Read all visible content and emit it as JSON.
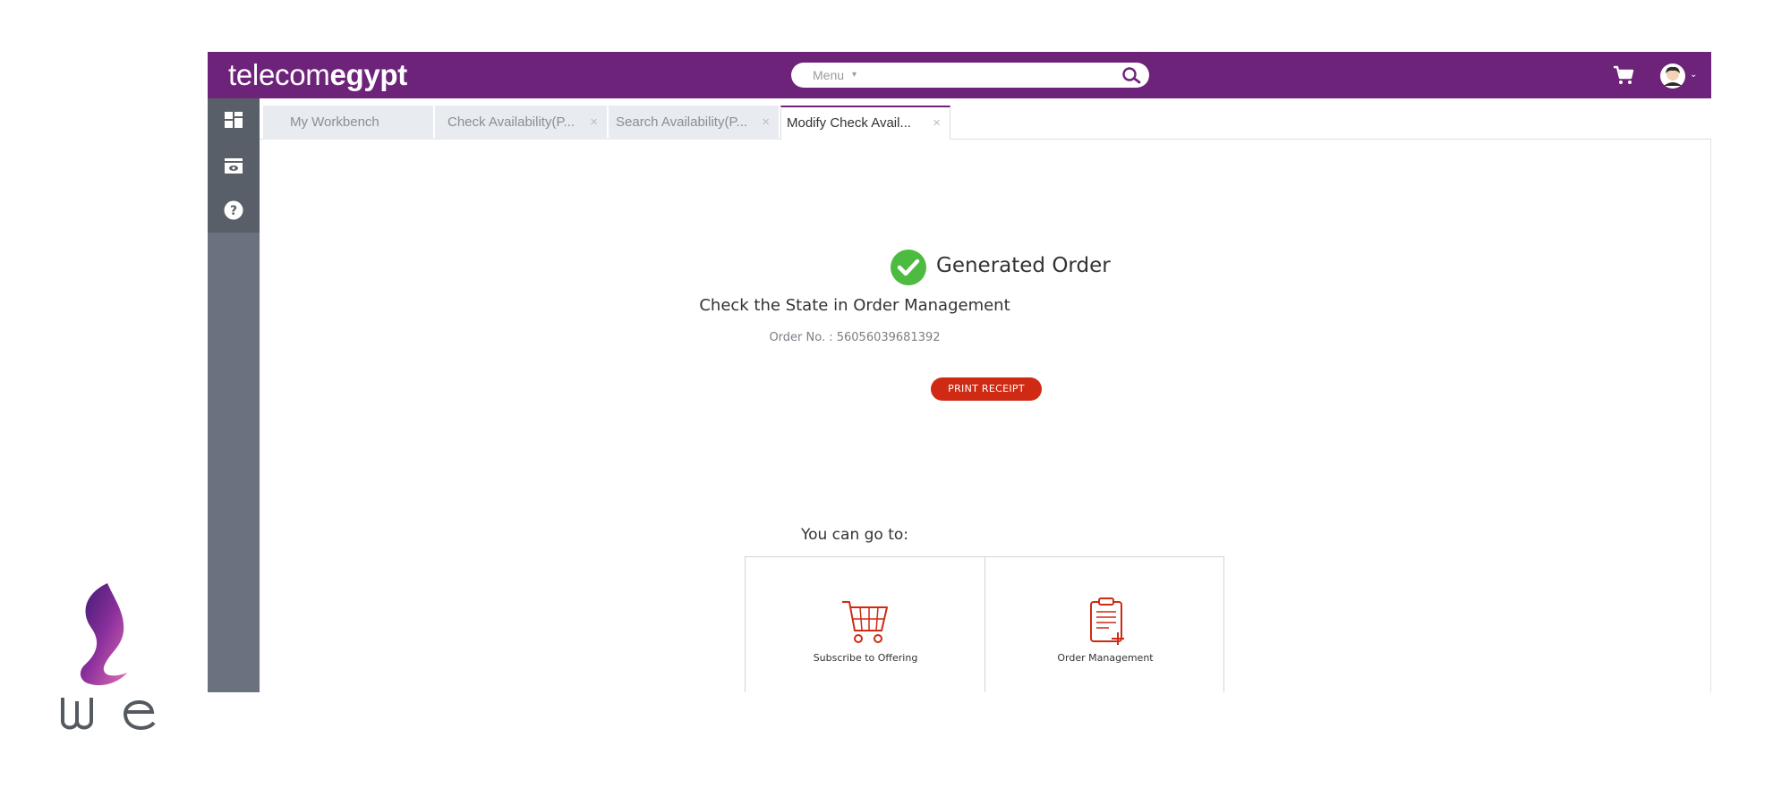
{
  "header": {
    "brand_light": "telecom",
    "brand_bold": "egypt",
    "menu_label": "Menu",
    "search_icon": "search-icon",
    "cart_icon": "cart-icon",
    "user_icon": "user-avatar-icon"
  },
  "sidebar": {
    "items": [
      {
        "icon": "dashboard-icon"
      },
      {
        "icon": "monitor-icon"
      },
      {
        "icon": "help-icon"
      }
    ]
  },
  "tabs": [
    {
      "label": "My Workbench",
      "closable": false,
      "active": false
    },
    {
      "label": "Check Availability(P...",
      "closable": true,
      "active": false
    },
    {
      "label": "Search Availability(P...",
      "closable": true,
      "active": false
    },
    {
      "label": "Modify Check Avail...",
      "closable": true,
      "active": true
    }
  ],
  "tab_close_glyph": "×",
  "result": {
    "title": "Generated Order",
    "subtitle": "Check the State in Order Management",
    "order_no": "Order No. : 56056039681392",
    "print_button": "PRINT RECEIPT"
  },
  "goto": {
    "label": "You can go to:",
    "items": [
      {
        "label": "Subscribe to Offering",
        "icon": "shopping-cart-icon"
      },
      {
        "label": "Order Management",
        "icon": "clipboard-add-icon"
      }
    ]
  },
  "logo": {
    "text": "we"
  },
  "colors": {
    "brand_purple": "#6e237a",
    "sidebar_dark": "#595f69",
    "sidebar": "#6a7280",
    "success_green": "#4cbb3f",
    "action_red": "#cf2a14"
  }
}
